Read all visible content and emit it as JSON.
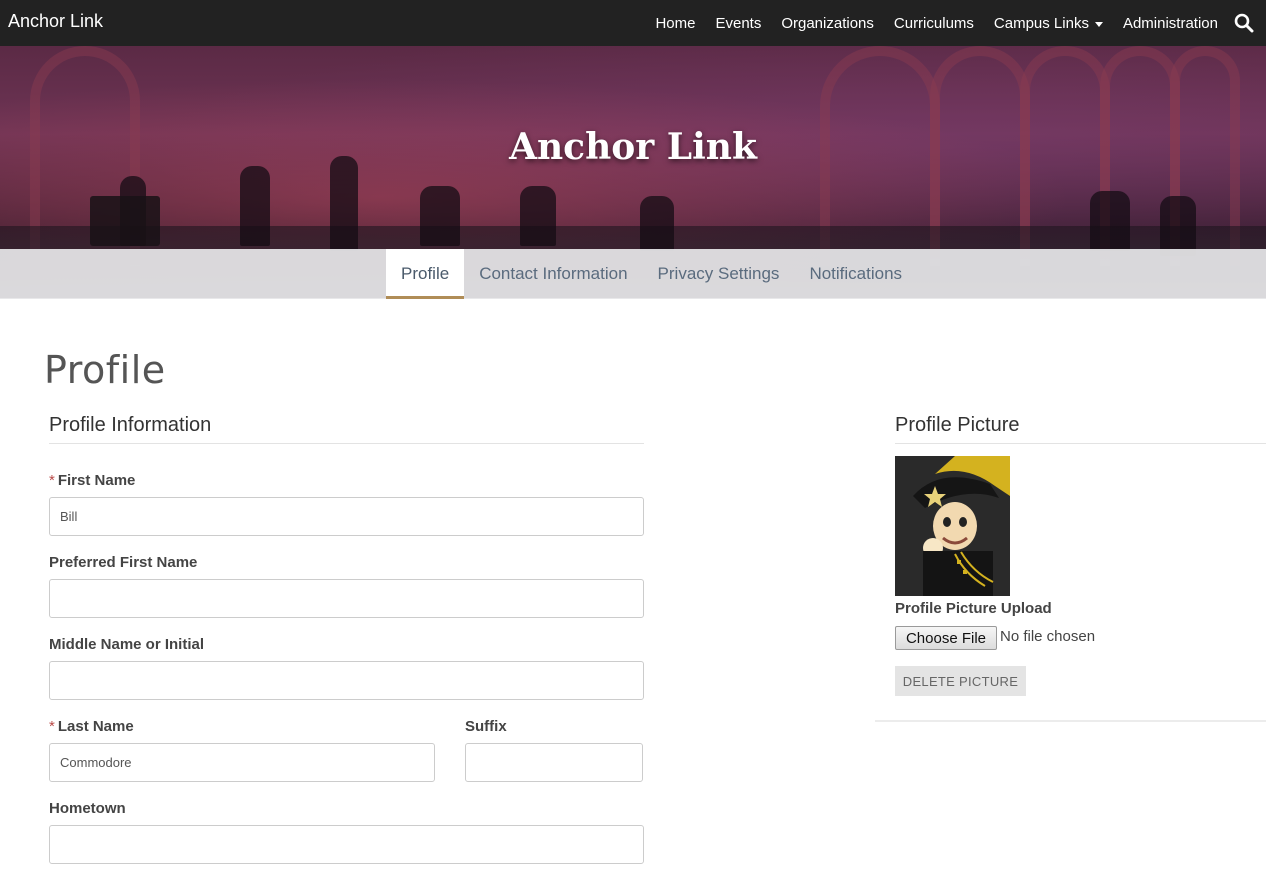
{
  "navbar": {
    "brand": "Anchor Link",
    "links": [
      "Home",
      "Events",
      "Organizations",
      "Curriculums",
      "Campus Links",
      "Administration"
    ],
    "search_icon": "search-icon",
    "dropdown_icon": "caret-down-icon"
  },
  "hero": {
    "title": "Anchor Link"
  },
  "tabs": [
    {
      "label": "Profile",
      "active": true
    },
    {
      "label": "Contact Information",
      "active": false
    },
    {
      "label": "Privacy Settings",
      "active": false
    },
    {
      "label": "Notifications",
      "active": false
    }
  ],
  "page": {
    "title": "Profile"
  },
  "profile_info": {
    "section_title": "Profile Information",
    "required_marker": "*",
    "first_name": {
      "label": "First Name",
      "value": "Bill"
    },
    "preferred_first_name": {
      "label": "Preferred First Name",
      "value": ""
    },
    "middle_name": {
      "label": "Middle Name or Initial",
      "value": ""
    },
    "last_name": {
      "label": "Last Name",
      "value": "Commodore"
    },
    "suffix": {
      "label": "Suffix",
      "value": ""
    },
    "hometown": {
      "label": "Hometown",
      "value": ""
    }
  },
  "profile_picture": {
    "section_title": "Profile Picture",
    "upload_label": "Profile Picture Upload",
    "choose_file_label": "Choose File",
    "no_file_text": "No file chosen",
    "delete_label": "DELETE PICTURE"
  },
  "colors": {
    "navbar_bg": "#222222",
    "tab_active_underline": "#b08d57",
    "tab_text": "#5a6b7e",
    "required": "#b94a48"
  }
}
